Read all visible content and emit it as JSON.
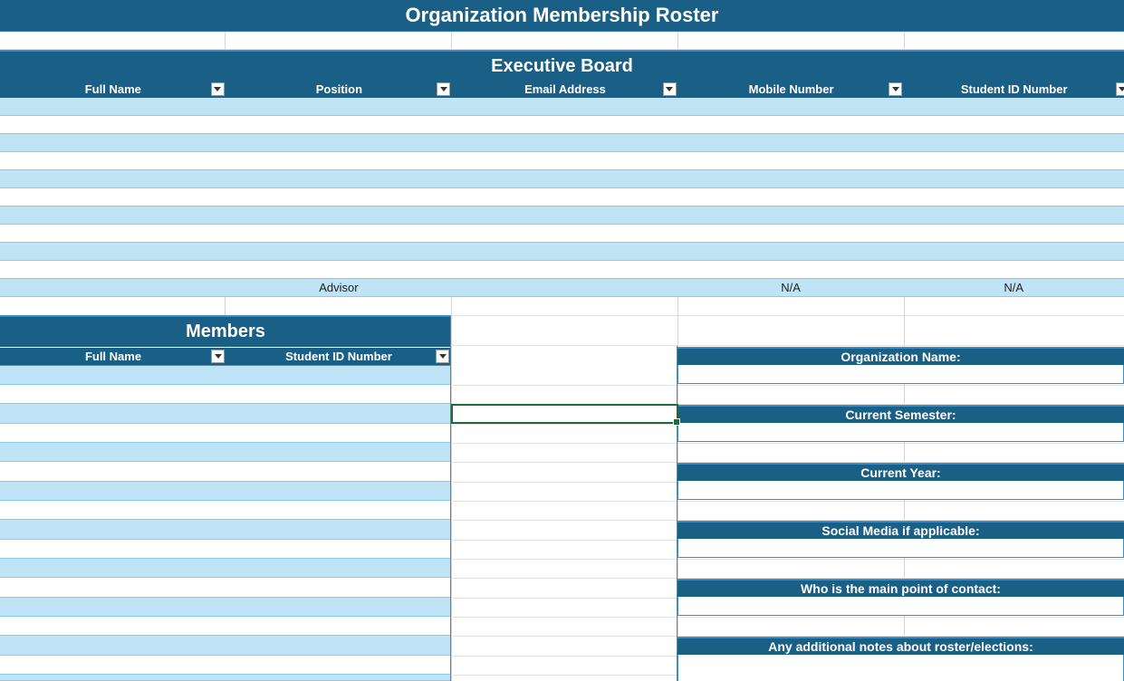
{
  "sheet": {
    "title": "Organization Membership Roster"
  },
  "executive_board": {
    "heading": "Executive Board",
    "columns": [
      "Full Name",
      "Position",
      "Email Address",
      "Mobile Number",
      "Student ID Number"
    ],
    "advisor_row": [
      "",
      "Advisor",
      "",
      "N/A",
      "N/A"
    ]
  },
  "members": {
    "heading": "Members",
    "columns": [
      "Full Name",
      "Student ID Number"
    ]
  },
  "info": {
    "org_name_label": "Organization Name:",
    "semester_label": "Current Semester:",
    "year_label": "Current Year:",
    "social_label": "Social Media if applicable:",
    "contact_label": "Who is the main point of contact:",
    "notes_label": "Any additional notes about roster/elections:"
  },
  "colors": {
    "header_bg": "#1a5f85",
    "band_light": "#bfe4f5",
    "accent_border": "#3b8ec6"
  }
}
